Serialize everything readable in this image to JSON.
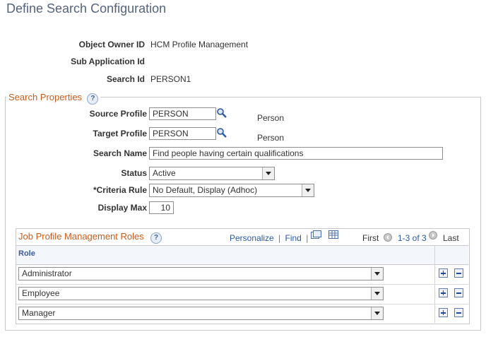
{
  "page_title": "Define Search Configuration",
  "fields": {
    "object_owner_label": "Object Owner ID",
    "object_owner_value": "HCM Profile Management",
    "sub_app_label": "Sub Application Id",
    "search_id_label": "Search Id",
    "search_id_value": "PERSON1"
  },
  "search_properties": {
    "title": "Search Properties",
    "source_profile_label": "Source Profile",
    "source_profile_value": "PERSON",
    "source_profile_desc": "Person",
    "target_profile_label": "Target Profile",
    "target_profile_value": "PERSON",
    "target_profile_desc": "Person",
    "search_name_label": "Search Name",
    "search_name_value": "Find people having certain qualifications",
    "status_label": "Status",
    "status_value": "Active",
    "criteria_rule_label": "*Criteria Rule",
    "criteria_rule_value": "No Default, Display (Adhoc)",
    "display_max_label": "Display Max",
    "display_max_value": "10"
  },
  "roles_grid": {
    "title": "Job Profile Management Roles",
    "personalize": "Personalize",
    "find": "Find",
    "sep": "|",
    "first": "First",
    "range": "1-3 of 3",
    "last": "Last",
    "col_role": "Role",
    "rows": [
      {
        "role": "Administrator"
      },
      {
        "role": "Employee"
      },
      {
        "role": "Manager"
      }
    ]
  },
  "help_glyph": "?",
  "icons": {
    "lookup": "magnifier-icon",
    "help": "help-icon",
    "add": "plus-icon",
    "remove": "minus-icon"
  },
  "colors": {
    "section_title": "#c85e1d",
    "link": "#2d5aa0",
    "page_title": "#55647b"
  }
}
